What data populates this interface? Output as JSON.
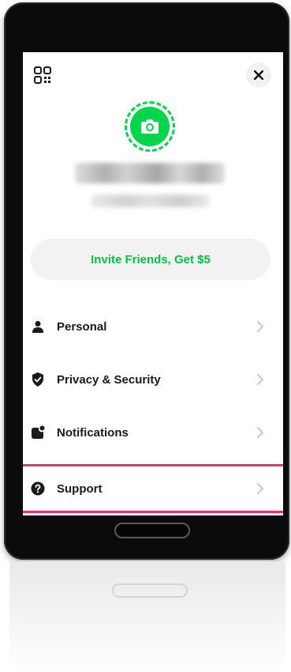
{
  "header": {
    "qr_icon": "qr-code-icon",
    "close_icon": "close-icon"
  },
  "profile": {
    "avatar_icon": "camera-icon",
    "accent_color": "#00d54b"
  },
  "invite": {
    "label": "Invite Friends, Get $5",
    "color": "#00c244"
  },
  "menu": {
    "items": [
      {
        "label": "Personal",
        "icon": "person-icon"
      },
      {
        "label": "Privacy & Security",
        "icon": "shield-check-icon"
      },
      {
        "label": "Notifications",
        "icon": "notification-icon"
      },
      {
        "label": "Support",
        "icon": "question-circle-icon"
      }
    ],
    "highlight_color": "#e8316d"
  }
}
